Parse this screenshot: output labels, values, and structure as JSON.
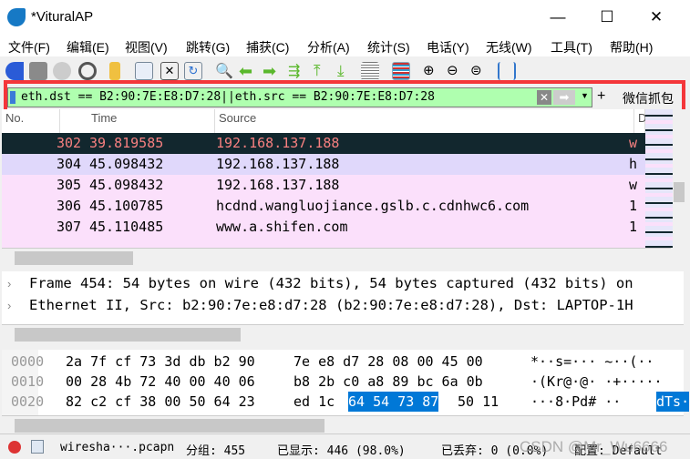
{
  "window": {
    "title": "*VituralAP",
    "minimize": "—",
    "maximize": "☐",
    "close": "✕"
  },
  "menu": [
    "文件(F)",
    "编辑(E)",
    "视图(V)",
    "跳转(G)",
    "捕获(C)",
    "分析(A)",
    "统计(S)",
    "电话(Y)",
    "无线(W)",
    "工具(T)",
    "帮助(H)"
  ],
  "filter": {
    "value": "eth.dst == B2:90:7E:E8:D7:28||eth.src == B2:90:7E:E8:D7:28",
    "add": "+",
    "button_label": "微信抓包"
  },
  "packet_list": {
    "columns": [
      "No.",
      "Time",
      "Source",
      "D"
    ],
    "rows": [
      {
        "no": "302",
        "time": "39.819585",
        "source": "192.168.137.188",
        "dest": "w"
      },
      {
        "no": "304",
        "time": "45.098432",
        "source": "192.168.137.188",
        "dest": "h"
      },
      {
        "no": "305",
        "time": "45.098432",
        "source": "192.168.137.188",
        "dest": "w"
      },
      {
        "no": "306",
        "time": "45.100785",
        "source": "hcdnd.wangluojiance.gslb.c.cdnhwc6.com",
        "dest": "1"
      },
      {
        "no": "307",
        "time": "45.110485",
        "source": "www.a.shifen.com",
        "dest": "1"
      }
    ]
  },
  "details": [
    "Frame 454: 54 bytes on wire (432 bits), 54 bytes captured (432 bits) on",
    "Ethernet II, Src: b2:90:7e:e8:d7:28 (b2:90:7e:e8:d7:28), Dst: LAPTOP-1H"
  ],
  "hex": [
    {
      "off": "0000",
      "a": "2a 7f cf 73 3d db b2 90",
      "b": "7e e8 d7 28 08 00 45 00",
      "ascii": "*··s=···  ~··(··"
    },
    {
      "off": "0010",
      "a": "00 28 4b 72 40 00 40 06",
      "b": "b8 2b c0 a8 89 bc 6a 0b",
      "ascii": "·(Kr@·@·  ·+·····"
    },
    {
      "off": "0020",
      "a": "82 c2 cf 38 00 50 64 23",
      "b1": "ed 1c",
      "bsel": "64 54 73 87",
      "b2": "50 11",
      "ascii": "···8·Pd#  ··",
      "asel": "dTs·"
    }
  ],
  "status": {
    "file": "wiresha···.pcapn",
    "packets": "分组: 455",
    "displayed": "已显示: 446 (98.0%)",
    "dropped": "已丢弃: 0 (0.0%)",
    "profile": "配置: Default",
    "watermark": "CSDN @Mr_Wu6666"
  }
}
